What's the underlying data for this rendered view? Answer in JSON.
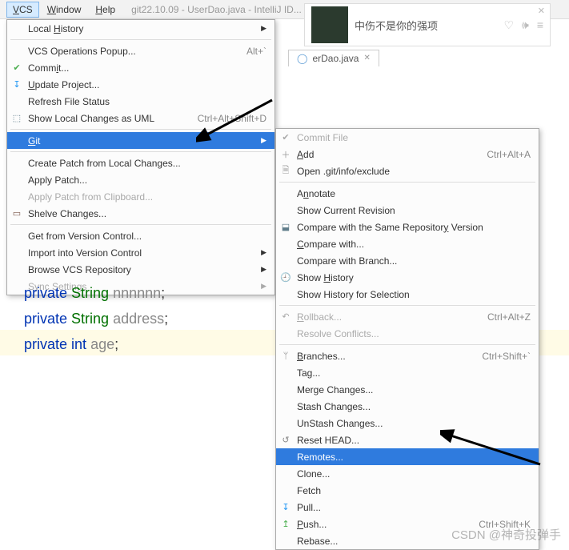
{
  "menubar": {
    "vcs": "VCS",
    "window": "Window",
    "help": "Help"
  },
  "title": "git22.10.09 - UserDao.java - IntelliJ ID...",
  "tab": {
    "label": "erDao.java"
  },
  "music": {
    "text": "中伤不是你的强项"
  },
  "menu1": {
    "localHistory": "Local History",
    "vcsOps": "VCS Operations Popup...",
    "vcsOpsKey": "Alt+`",
    "commit": "Commit...",
    "update": "Update Project...",
    "refresh": "Refresh File Status",
    "uml": "Show Local Changes as UML",
    "umlKey": "Ctrl+Alt+Shift+D",
    "git": "Git",
    "createPatch": "Create Patch from Local Changes...",
    "applyPatch": "Apply Patch...",
    "applyClip": "Apply Patch from Clipboard...",
    "shelve": "Shelve Changes...",
    "getVC": "Get from Version Control...",
    "importVC": "Import into Version Control",
    "browse": "Browse VCS Repository",
    "sync": "Sync Settings"
  },
  "menu2": {
    "commitFile": "Commit File",
    "add": "Add",
    "addKey": "Ctrl+Alt+A",
    "openExclude": "Open .git/info/exclude",
    "annotate": "Annotate",
    "showRev": "Show Current Revision",
    "compareSame": "Compare with the Same Repository Version",
    "compareWith": "Compare with...",
    "compareBranch": "Compare with Branch...",
    "showHist": "Show History",
    "showHistSel": "Show History for Selection",
    "rollback": "Rollback...",
    "rollbackKey": "Ctrl+Alt+Z",
    "resolve": "Resolve Conflicts...",
    "branches": "Branches...",
    "branchesKey": "Ctrl+Shift+`",
    "tag": "Tag...",
    "merge": "Merge Changes...",
    "stash": "Stash Changes...",
    "unstash": "UnStash Changes...",
    "reset": "Reset HEAD...",
    "remotes": "Remotes...",
    "clone": "Clone...",
    "fetch": "Fetch",
    "pull": "Pull...",
    "push": "Push...",
    "pushKey": "Ctrl+Shift+K",
    "rebase": "Rebase..."
  },
  "code": {
    "l1a": "private",
    "l1b": "String",
    "l1c": "nnnnnn",
    "l2a": "private",
    "l2b": "String",
    "l2c": "address",
    "l3a": "private",
    "l3b": "int",
    "l3c": "age"
  },
  "watermark": "CSDN @神奇投弹手"
}
